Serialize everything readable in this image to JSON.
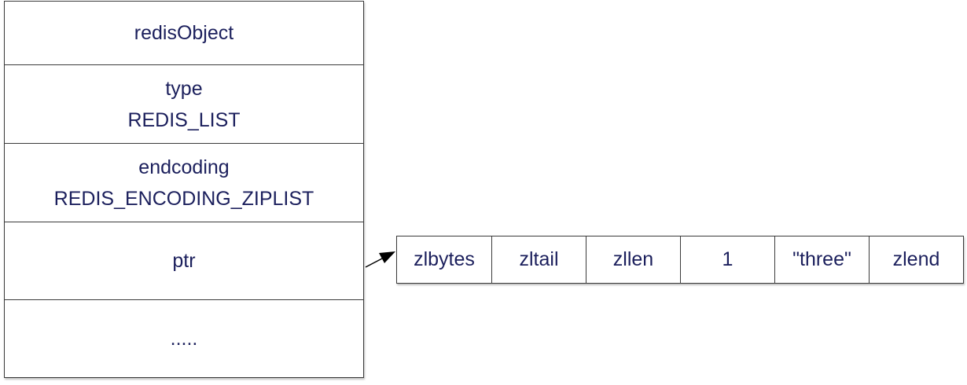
{
  "redis_object": {
    "title": "redisObject",
    "type_label": "type",
    "type_value": "REDIS_LIST",
    "encoding_label": "endcoding",
    "encoding_value": "REDIS_ENCODING_ZIPLIST",
    "ptr_label": "ptr",
    "more_label": "....."
  },
  "ziplist": {
    "cells": [
      "zlbytes",
      "zltail",
      "zllen",
      "1",
      "\"three\"",
      "zlend"
    ]
  },
  "colors": {
    "text": "#1b1f5c",
    "border": "#3a3a3a"
  }
}
